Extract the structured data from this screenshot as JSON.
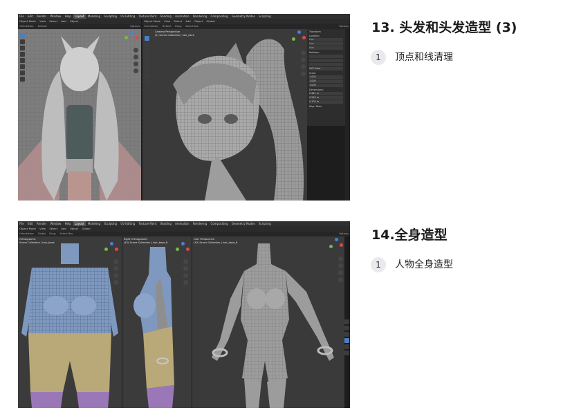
{
  "sections": [
    {
      "title": "13. 头发和头发造型 (3)",
      "steps": [
        {
          "num": "1",
          "text": "顶点和线清理"
        }
      ],
      "screenshot": {
        "menu": [
          "File",
          "Edit",
          "Render",
          "Window",
          "Help"
        ],
        "workspaces": [
          "Layout",
          "Modeling",
          "Sculpting",
          "UV Editing",
          "Texture Paint",
          "Shading",
          "Animation",
          "Rendering",
          "Compositing",
          "Geometry Nodes",
          "Scripting"
        ],
        "active_workspace": "Layout",
        "left_header": [
          "Object Mode",
          "View",
          "Select",
          "Add",
          "Object"
        ],
        "left_orientation": [
          "Orientation:",
          "Default",
          "Options"
        ],
        "right_header": [
          "Object Mode",
          "View",
          "Select",
          "Add",
          "Object",
          "Global"
        ],
        "right_orientation": [
          "Orientation:",
          "Default",
          "Drag:",
          "Select Box"
        ],
        "options_label": "Options",
        "view_name": "Camera Perspective",
        "collection": "(1) Scene Collection | hair_back",
        "panel": {
          "title": "Transform",
          "sections": [
            "Location:",
            "Rotation:",
            "XYZ Euler",
            "Scale:",
            "Dimensions:"
          ],
          "location": [
            "0 m",
            "0 m",
            "0 m"
          ],
          "scale": [
            "1.000",
            "1.000",
            "1.000"
          ],
          "dimensions": [
            "0.341 m",
            "0.249 m",
            "0.703 m"
          ],
          "footer": "Align Tools"
        }
      }
    },
    {
      "title": "14.全身造型",
      "steps": [
        {
          "num": "1",
          "text": "人物全身造型"
        }
      ],
      "screenshot": {
        "menu": [
          "File",
          "Edit",
          "Render",
          "Window",
          "Help"
        ],
        "workspaces": [
          "Layout",
          "Modeling",
          "Sculpting",
          "UV Editing",
          "Texture Paint",
          "Shading",
          "Animation",
          "Rendering",
          "Compositing",
          "Geometry Nodes",
          "Scripting"
        ],
        "active_workspace": "Layout",
        "header": [
          "Object Mode",
          "View",
          "Select",
          "Add",
          "Object",
          "Global"
        ],
        "orientation": [
          "Orientation:",
          "Global",
          "Drag:",
          "Select Box"
        ],
        "options_label": "Options",
        "views": [
          {
            "name": "Orthographic",
            "collection": "Scene Collection | hair_base"
          },
          {
            "name": "Right Orthographic",
            "collection": "(42) Scene Collection | hair_base_R"
          },
          {
            "name": "User Perspective",
            "collection": "(42) Scene Collection | hair_base_R"
          }
        ]
      }
    }
  ],
  "colors": {
    "blender_bg": "#1d1d1d",
    "viewport_grey": "#3a3a3a",
    "sweater_blue": "#7e98bf",
    "shorts_tan": "#b9a978",
    "leggings_purple": "#9a78b8",
    "skin_grey": "#9c9c9c",
    "accent_blue": "#4a7fc1"
  }
}
